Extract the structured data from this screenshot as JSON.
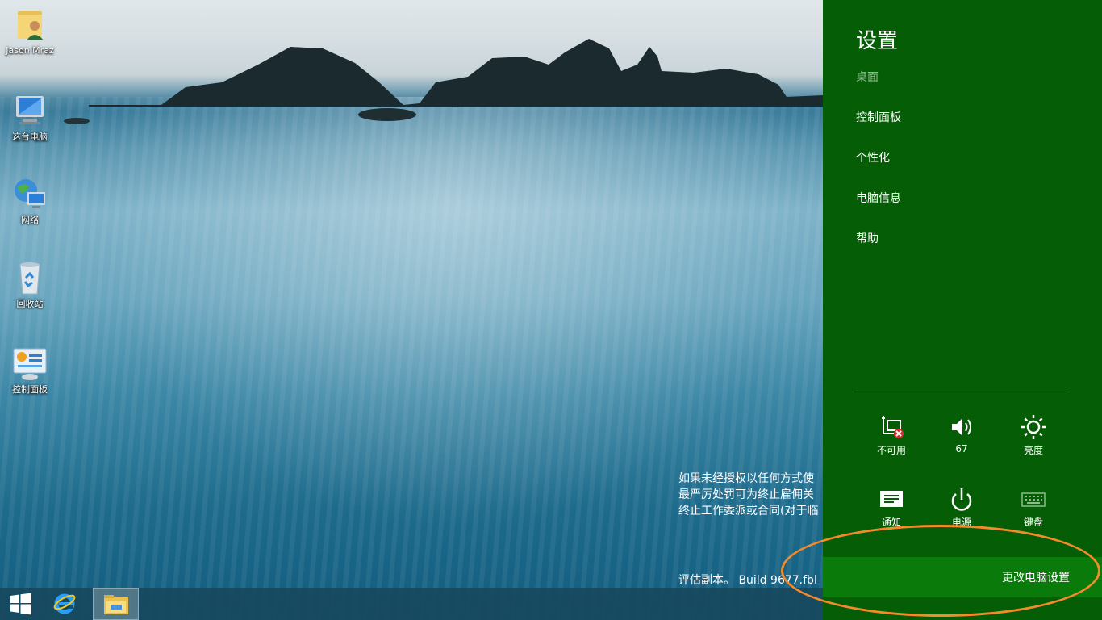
{
  "desktop": {
    "icons": [
      {
        "label": "Jason Mraz"
      },
      {
        "label": "这台电脑"
      },
      {
        "label": "网络"
      },
      {
        "label": "回收站"
      },
      {
        "label": "控制面板"
      }
    ],
    "watermark_lines": [
      "如果未经授权以任何方式使",
      "最严厉处罚可为终止雇佣关",
      "终止工作委派或合同(对于临"
    ],
    "build_text": "评估副本。 Build 9677.fbl"
  },
  "charm": {
    "title": "设置",
    "subtitle": "桌面",
    "links": [
      "控制面板",
      "个性化",
      "电脑信息",
      "帮助"
    ],
    "tiles": [
      {
        "label": "不可用",
        "icon": "network-unavailable-icon"
      },
      {
        "label": "67",
        "icon": "volume-icon"
      },
      {
        "label": "亮度",
        "icon": "brightness-icon"
      },
      {
        "label": "通知",
        "icon": "notifications-icon"
      },
      {
        "label": "电源",
        "icon": "power-icon"
      },
      {
        "label": "键盘",
        "icon": "keyboard-icon"
      }
    ],
    "change_settings": "更改电脑设置",
    "background": "#055e05"
  },
  "highlight_color": "#f58a2b"
}
